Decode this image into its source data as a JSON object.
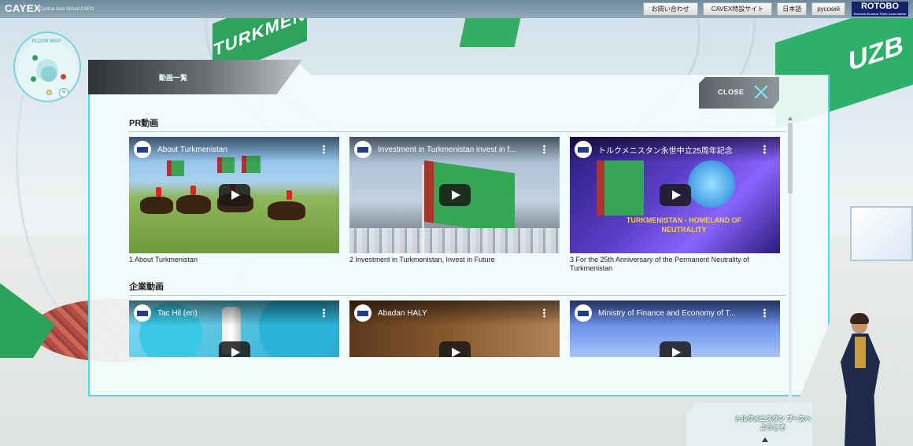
{
  "header": {
    "logo": "CAYEX",
    "logo_sub": "Central Asia Virtual EXPO",
    "links": [
      {
        "label": "お問い合わせ"
      },
      {
        "label": "CAVEX特設サイト"
      }
    ],
    "languages": [
      {
        "label": "日本語"
      },
      {
        "label": "русский"
      }
    ],
    "partner_logo": "ROTOBO",
    "partner_sub": "Russian-Eurasia Trade Association"
  },
  "floor_map": {
    "label": "FLOOR MAP"
  },
  "background": {
    "banner_left": "TURKMEN",
    "banner_right": "UZB"
  },
  "modal": {
    "title": "動画一覧",
    "close_label": "CLOSE",
    "sections": [
      {
        "heading": "PR動画",
        "videos": [
          {
            "title": "About Turkmenistan",
            "caption": "1 About Turkmenistan"
          },
          {
            "title": "Investment in Turkmenistan invest in f...",
            "caption": "2 Investment in Turkmenistan, Invest in Future"
          },
          {
            "title": "トルクメニスタン永世中立25周年記念",
            "caption": "3 For the 25th Anniversary of the Permanent Neutrality of Turkmenistan",
            "banner": "TURKMENISTAN - HOMELAND OF NEUTRALITY"
          }
        ]
      },
      {
        "heading": "企業動画",
        "videos": [
          {
            "title": "Tac Hil (en)"
          },
          {
            "title": "Abadan HALY"
          },
          {
            "title": "Ministry of Finance and Economy of T..."
          }
        ]
      }
    ]
  },
  "guide": {
    "label": "トルクメニスタン ブースへようこそ"
  }
}
